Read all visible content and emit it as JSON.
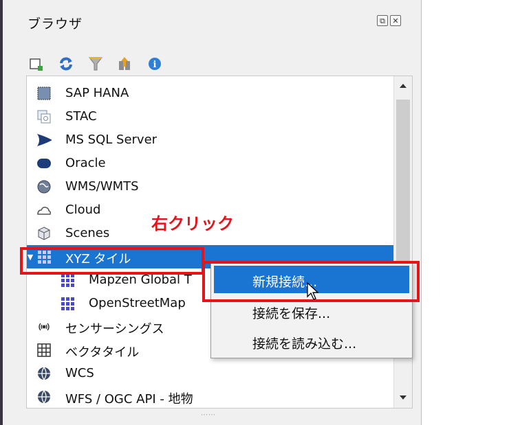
{
  "panel": {
    "title": "ブラウザ",
    "dock_buttons": [
      "float-icon",
      "close-icon"
    ],
    "toolbar": [
      "add-layer-icon",
      "refresh-icon",
      "filter-icon",
      "collapse-icon",
      "info-icon"
    ]
  },
  "tree": {
    "items": [
      {
        "label": "SAP HANA",
        "icon": "sap-hana-icon"
      },
      {
        "label": "STAC",
        "icon": "stac-icon"
      },
      {
        "label": "MS SQL Server",
        "icon": "mssql-icon"
      },
      {
        "label": "Oracle",
        "icon": "oracle-icon"
      },
      {
        "label": "WMS/WMTS",
        "icon": "globe-icon"
      },
      {
        "label": "Cloud",
        "icon": "cloud-icon"
      },
      {
        "label": "Scenes",
        "icon": "scenes-icon"
      },
      {
        "label": "XYZ タイル",
        "icon": "xyz-grid-icon",
        "selected": true
      },
      {
        "label": "Mapzen Global T",
        "icon": "xyz-grid-icon"
      },
      {
        "label": "OpenStreetMap",
        "icon": "xyz-grid-icon"
      },
      {
        "label": "センサーシングス",
        "icon": "sensor-icon"
      },
      {
        "label": "ベクタタイル",
        "icon": "vector-tile-icon"
      },
      {
        "label": "WCS",
        "icon": "globe-icon"
      },
      {
        "label": "WFS / OGC API - 地物",
        "icon": "globe-icon"
      }
    ]
  },
  "context_menu": {
    "items": [
      {
        "label": "新規接続...",
        "highlighted": true
      },
      {
        "label": "接続を保存..."
      },
      {
        "label": "接続を読み込む..."
      }
    ]
  },
  "annotation": {
    "text": "右クリック",
    "color": "#e3141a"
  },
  "colors": {
    "selection": "#1a74d1",
    "highlight_box": "#e3141a"
  }
}
